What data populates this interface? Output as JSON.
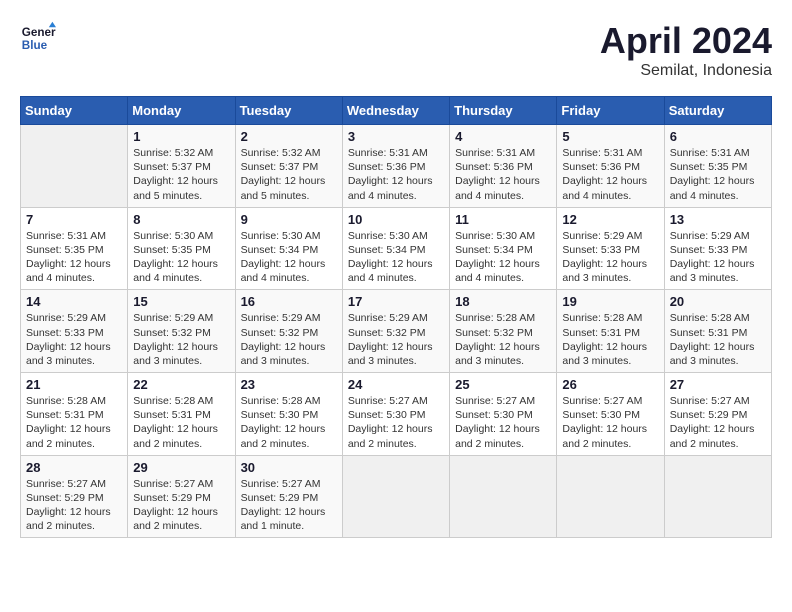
{
  "header": {
    "logo_line1": "General",
    "logo_line2": "Blue",
    "month": "April 2024",
    "location": "Semilat, Indonesia"
  },
  "days_of_week": [
    "Sunday",
    "Monday",
    "Tuesday",
    "Wednesday",
    "Thursday",
    "Friday",
    "Saturday"
  ],
  "weeks": [
    [
      {
        "day": null
      },
      {
        "day": "1",
        "sunrise": "5:32 AM",
        "sunset": "5:37 PM",
        "daylight": "12 hours and 5 minutes."
      },
      {
        "day": "2",
        "sunrise": "5:32 AM",
        "sunset": "5:37 PM",
        "daylight": "12 hours and 5 minutes."
      },
      {
        "day": "3",
        "sunrise": "5:31 AM",
        "sunset": "5:36 PM",
        "daylight": "12 hours and 4 minutes."
      },
      {
        "day": "4",
        "sunrise": "5:31 AM",
        "sunset": "5:36 PM",
        "daylight": "12 hours and 4 minutes."
      },
      {
        "day": "5",
        "sunrise": "5:31 AM",
        "sunset": "5:36 PM",
        "daylight": "12 hours and 4 minutes."
      },
      {
        "day": "6",
        "sunrise": "5:31 AM",
        "sunset": "5:35 PM",
        "daylight": "12 hours and 4 minutes."
      }
    ],
    [
      {
        "day": "7",
        "sunrise": "5:31 AM",
        "sunset": "5:35 PM",
        "daylight": "12 hours and 4 minutes."
      },
      {
        "day": "8",
        "sunrise": "5:30 AM",
        "sunset": "5:35 PM",
        "daylight": "12 hours and 4 minutes."
      },
      {
        "day": "9",
        "sunrise": "5:30 AM",
        "sunset": "5:34 PM",
        "daylight": "12 hours and 4 minutes."
      },
      {
        "day": "10",
        "sunrise": "5:30 AM",
        "sunset": "5:34 PM",
        "daylight": "12 hours and 4 minutes."
      },
      {
        "day": "11",
        "sunrise": "5:30 AM",
        "sunset": "5:34 PM",
        "daylight": "12 hours and 4 minutes."
      },
      {
        "day": "12",
        "sunrise": "5:29 AM",
        "sunset": "5:33 PM",
        "daylight": "12 hours and 3 minutes."
      },
      {
        "day": "13",
        "sunrise": "5:29 AM",
        "sunset": "5:33 PM",
        "daylight": "12 hours and 3 minutes."
      }
    ],
    [
      {
        "day": "14",
        "sunrise": "5:29 AM",
        "sunset": "5:33 PM",
        "daylight": "12 hours and 3 minutes."
      },
      {
        "day": "15",
        "sunrise": "5:29 AM",
        "sunset": "5:32 PM",
        "daylight": "12 hours and 3 minutes."
      },
      {
        "day": "16",
        "sunrise": "5:29 AM",
        "sunset": "5:32 PM",
        "daylight": "12 hours and 3 minutes."
      },
      {
        "day": "17",
        "sunrise": "5:29 AM",
        "sunset": "5:32 PM",
        "daylight": "12 hours and 3 minutes."
      },
      {
        "day": "18",
        "sunrise": "5:28 AM",
        "sunset": "5:32 PM",
        "daylight": "12 hours and 3 minutes."
      },
      {
        "day": "19",
        "sunrise": "5:28 AM",
        "sunset": "5:31 PM",
        "daylight": "12 hours and 3 minutes."
      },
      {
        "day": "20",
        "sunrise": "5:28 AM",
        "sunset": "5:31 PM",
        "daylight": "12 hours and 3 minutes."
      }
    ],
    [
      {
        "day": "21",
        "sunrise": "5:28 AM",
        "sunset": "5:31 PM",
        "daylight": "12 hours and 2 minutes."
      },
      {
        "day": "22",
        "sunrise": "5:28 AM",
        "sunset": "5:31 PM",
        "daylight": "12 hours and 2 minutes."
      },
      {
        "day": "23",
        "sunrise": "5:28 AM",
        "sunset": "5:30 PM",
        "daylight": "12 hours and 2 minutes."
      },
      {
        "day": "24",
        "sunrise": "5:27 AM",
        "sunset": "5:30 PM",
        "daylight": "12 hours and 2 minutes."
      },
      {
        "day": "25",
        "sunrise": "5:27 AM",
        "sunset": "5:30 PM",
        "daylight": "12 hours and 2 minutes."
      },
      {
        "day": "26",
        "sunrise": "5:27 AM",
        "sunset": "5:30 PM",
        "daylight": "12 hours and 2 minutes."
      },
      {
        "day": "27",
        "sunrise": "5:27 AM",
        "sunset": "5:29 PM",
        "daylight": "12 hours and 2 minutes."
      }
    ],
    [
      {
        "day": "28",
        "sunrise": "5:27 AM",
        "sunset": "5:29 PM",
        "daylight": "12 hours and 2 minutes."
      },
      {
        "day": "29",
        "sunrise": "5:27 AM",
        "sunset": "5:29 PM",
        "daylight": "12 hours and 2 minutes."
      },
      {
        "day": "30",
        "sunrise": "5:27 AM",
        "sunset": "5:29 PM",
        "daylight": "12 hours and 1 minute."
      },
      {
        "day": null
      },
      {
        "day": null
      },
      {
        "day": null
      },
      {
        "day": null
      }
    ]
  ]
}
